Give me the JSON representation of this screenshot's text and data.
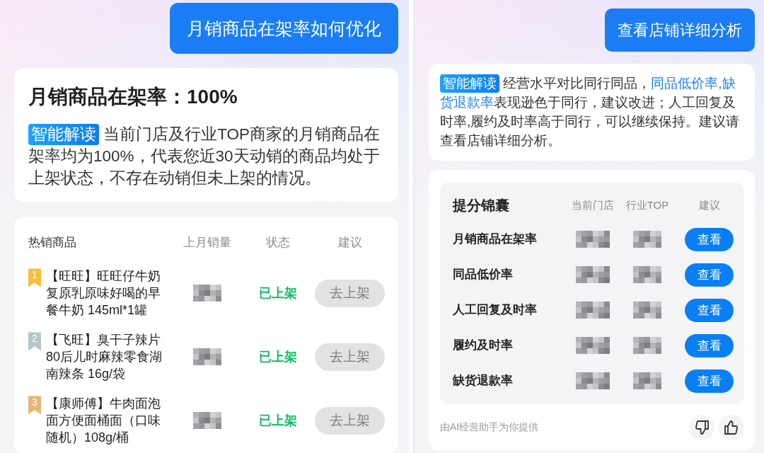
{
  "left_chat": {
    "user_message": "月销商品在架率如何优化",
    "summary_card": {
      "title": "月销商品在架率：100%",
      "tag": "智能解读",
      "text": [
        {
          "text": "当前门店及行业TOP商家的月销商品在架率均为100%，代表您近30天动销的商品均处于上架状态，不存在动销但未上架的情况。",
          "highlight": false
        }
      ]
    },
    "product_table": {
      "columns": [
        "热销商品",
        "上月销量",
        "状态",
        "建议"
      ],
      "rows": [
        {
          "rank": "1",
          "color": "#f6bf3c",
          "name": "【旺旺】旺旺仔牛奶复原乳原味好喝的早餐牛奶 145ml*1罐",
          "status": "已上架",
          "action": {
            "label": "去上架",
            "disabled": true
          }
        },
        {
          "rank": "2",
          "color": "#b3c6c8",
          "name": "【飞旺】臭干子辣片80后儿时麻辣零食湖南辣条 16g/袋",
          "status": "已上架",
          "action": {
            "label": "去上架",
            "disabled": true
          }
        },
        {
          "rank": "3",
          "color": "#e8b676",
          "name": "【康师傅】牛肉面泡面方便面桶面（口味随机）108g/桶",
          "status": "已上架",
          "action": {
            "label": "去上架",
            "disabled": true
          }
        }
      ]
    }
  },
  "right_chat": {
    "user_message": "查看店铺详细分析",
    "insight_card": {
      "tag": "智能解读",
      "text": [
        {
          "text": "经营水平对比同行同品，",
          "highlight": false
        },
        {
          "text": "同品低价率,缺货退款率",
          "highlight": true
        },
        {
          "text": "表现逊色于同行，建议改进；人工回复及时率,履约及时率高于同行，可以继续保持。建议请查看店铺详细分析。",
          "highlight": false
        }
      ]
    },
    "tips_card": {
      "title": "提分锦囊",
      "columns": [
        "当前门店",
        "行业TOP",
        "建议"
      ],
      "rows": [
        {
          "metric": "月销商品在架率",
          "action": {
            "label": "查看",
            "disabled": false
          }
        },
        {
          "metric": "同品低价率",
          "action": {
            "label": "查看",
            "disabled": false
          }
        },
        {
          "metric": "人工回复及时率",
          "action": {
            "label": "查看",
            "disabled": false
          }
        },
        {
          "metric": "履约及时率",
          "action": {
            "label": "查看",
            "disabled": false
          }
        },
        {
          "metric": "缺货退款率",
          "action": {
            "label": "查看",
            "disabled": false
          }
        }
      ],
      "footer": "由AI经营助手为你提供"
    }
  }
}
